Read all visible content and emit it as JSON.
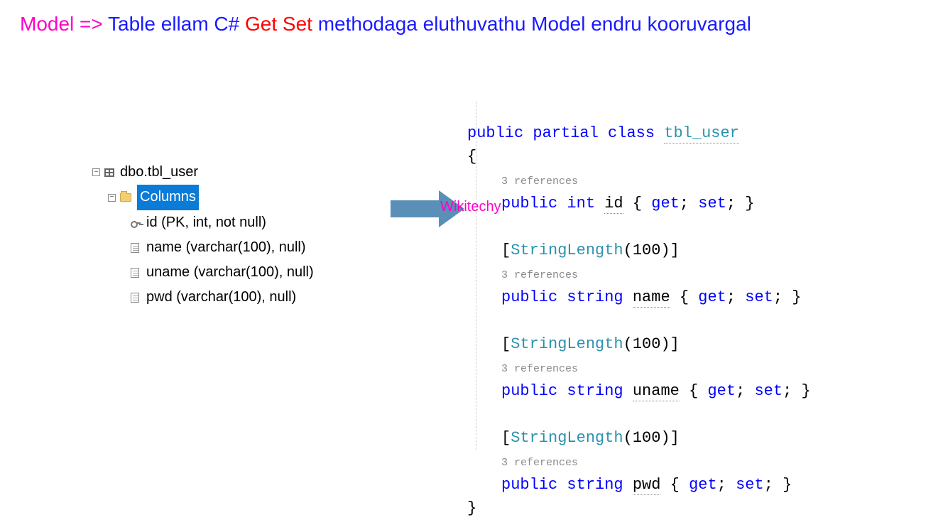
{
  "heading": {
    "part1": "Model =>",
    "part2": " Table ellam C# ",
    "part3": "Get Set",
    "part4": " methodaga eluthuvathu Model endru kooruvargal"
  },
  "tree": {
    "tableName": "dbo.tbl_user",
    "columnsLabel": "Columns",
    "columns": [
      {
        "text": "id (PK, int, not null)",
        "pk": true
      },
      {
        "text": "name (varchar(100), null)",
        "pk": false
      },
      {
        "text": "uname (varchar(100), null)",
        "pk": false
      },
      {
        "text": "pwd (varchar(100), null)",
        "pk": false
      }
    ]
  },
  "watermark": "Wikitechy",
  "code": {
    "keyword_public": "public",
    "keyword_partial": "partial",
    "keyword_class": "class",
    "keyword_int": "int",
    "keyword_string": "string",
    "keyword_get": "get",
    "keyword_set": "set",
    "className": "tbl_user",
    "refsText": "3 references",
    "attribute_type": "StringLength",
    "attribute_arg": "100",
    "prop_id": "id",
    "prop_name": "name",
    "prop_uname": "uname",
    "prop_pwd": "pwd",
    "open_brace": "{",
    "close_brace": "}",
    "open_bracket": "[",
    "close_bracket": "]",
    "open_paren": "(",
    "close_paren": ")",
    "semicolon": ";"
  }
}
